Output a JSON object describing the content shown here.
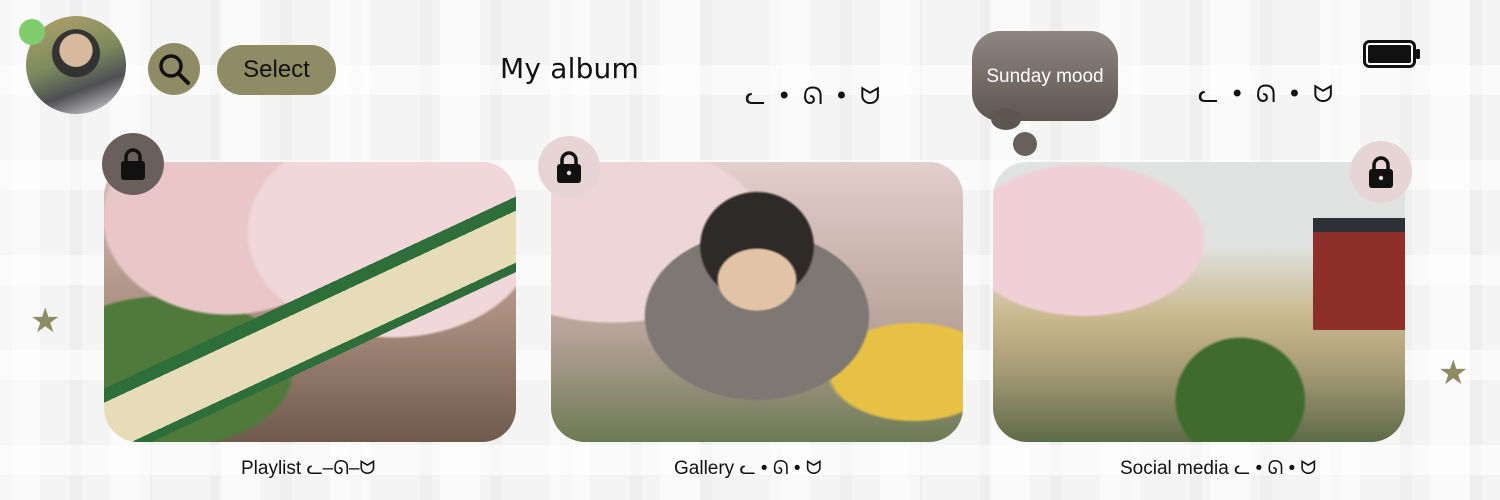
{
  "header": {
    "title": "My album",
    "select_label": "Select",
    "search_icon": "search-icon",
    "avatar_icon": "profile-avatar",
    "status_dot_color": "#7fcd6d",
    "battery_icon": "battery-full-icon"
  },
  "decorations": {
    "glyphs_left": "ᓚ • ᘏ • ᗢ",
    "glyphs_right": "ᓚ • ᘏ • ᗢ",
    "star_icon": "star-icon"
  },
  "bubble": {
    "text": "Sunday mood"
  },
  "cards": [
    {
      "caption": "Playlist ᓚ‒ᘏ‒ᗢ",
      "lock_icon": "lock-icon"
    },
    {
      "caption": "Gallery  ᓚ • ᘏ • ᗢ",
      "lock_icon": "lock-icon"
    },
    {
      "caption": "Social media ᓚ • ᘏ • ᗢ",
      "lock_icon": "lock-icon"
    }
  ],
  "colors": {
    "accent": "#8f8b64",
    "bubble": "#6f6460",
    "lock_dark": "#6b5f5b",
    "lock_light": "#e7d4d4"
  }
}
